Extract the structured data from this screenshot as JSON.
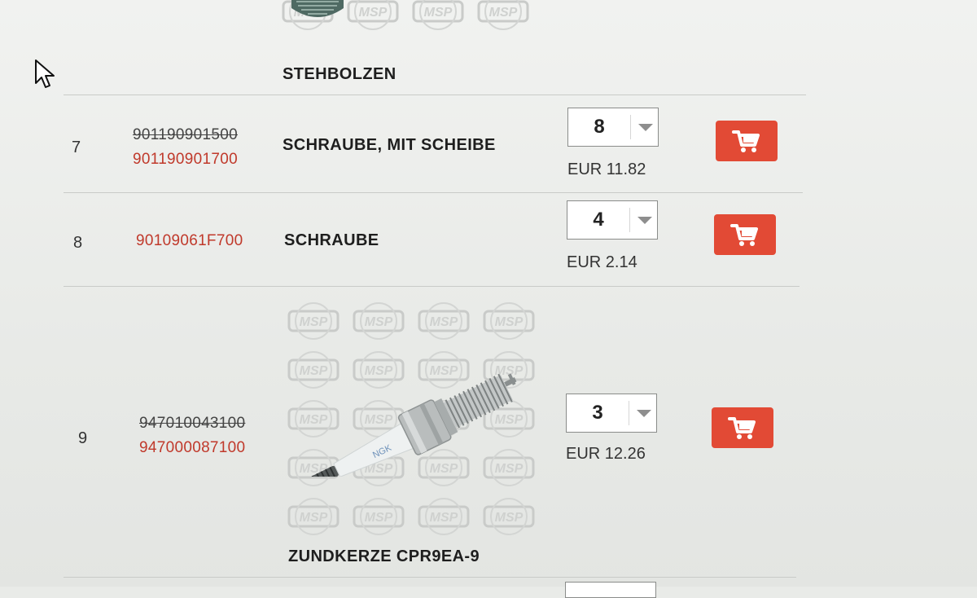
{
  "rows": [
    {
      "name": "STEHBOLZEN"
    },
    {
      "position": "7",
      "old_number": "901190901500",
      "new_number": "901190901700",
      "name": "SCHRAUBE, MIT SCHEIBE",
      "quantity": "8",
      "price": "EUR 11.82"
    },
    {
      "position": "8",
      "new_number": "90109061F700",
      "name": "SCHRAUBE",
      "quantity": "4",
      "price": "EUR 2.14"
    },
    {
      "position": "9",
      "old_number": "947010043100",
      "new_number": "947000087100",
      "name": "ZUNDKERZE CPR9EA-9",
      "quantity": "3",
      "price": "EUR 12.26"
    }
  ],
  "watermark_text": "MSP",
  "colors": {
    "accent": "#e24a35",
    "part_number_red": "#c0392b"
  },
  "icons": {
    "cart": "cart-icon",
    "dropdown": "chevron-down-icon",
    "cursor": "mouse-pointer-icon"
  }
}
